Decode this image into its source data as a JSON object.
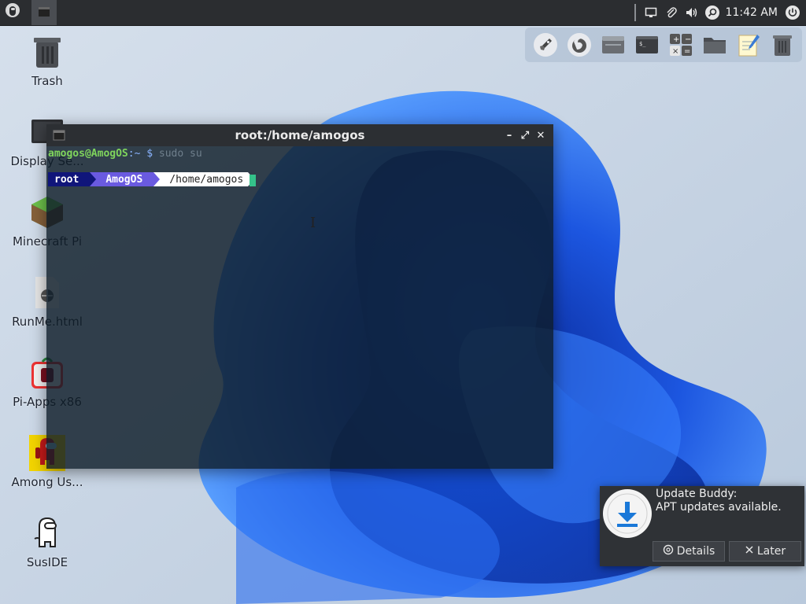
{
  "panel": {
    "clock": "11:42 AM",
    "tray_icons": [
      "screen-icon",
      "paperclip-icon",
      "volume-icon",
      "search-icon"
    ],
    "power_icon": "power-icon"
  },
  "dock": {
    "items": [
      "rocket-icon",
      "firefox-icon",
      "window-icon",
      "terminal-icon",
      "calculator-icon",
      "folder-icon",
      "notepad-icon",
      "trash-icon"
    ]
  },
  "desktop": {
    "icons": [
      {
        "label": "Trash",
        "icon": "trash-icon"
      },
      {
        "label": "Display Se...",
        "icon": "monitor-icon"
      },
      {
        "label": "Minecraft Pi",
        "icon": "minecraft-icon"
      },
      {
        "label": "RunMe.html",
        "icon": "html-file-icon"
      },
      {
        "label": "Pi-Apps x86",
        "icon": "pi-apps-icon"
      },
      {
        "label": "Among Us...",
        "icon": "among-us-icon"
      },
      {
        "label": "SusIDE",
        "icon": "suside-icon"
      }
    ]
  },
  "terminal": {
    "title": "root:/home/amogos",
    "line1_user": "amogos@AmogOS",
    "line1_path": ":~",
    "line1_dollar": "$",
    "line1_cmd": "sudo su",
    "prompt_user": "root",
    "prompt_host": "AmogOS",
    "prompt_dir": "/home/amogos",
    "controls": {
      "minimize": "–",
      "maximize": "⤢",
      "close": "✕"
    }
  },
  "notification": {
    "title": "Update Buddy:",
    "message": "APT updates available.",
    "details_label": "Details",
    "later_label": "Later"
  },
  "colors": {
    "panel_bg": "#2b2d30",
    "terminal_title_bg": "#2c2f33",
    "prompt_green": "#7fd45c",
    "powerline_root": "#10157a",
    "powerline_host": "#6a5ae0",
    "cursor": "#35c28a",
    "wallpaper_blue": "#1f5ad8"
  }
}
